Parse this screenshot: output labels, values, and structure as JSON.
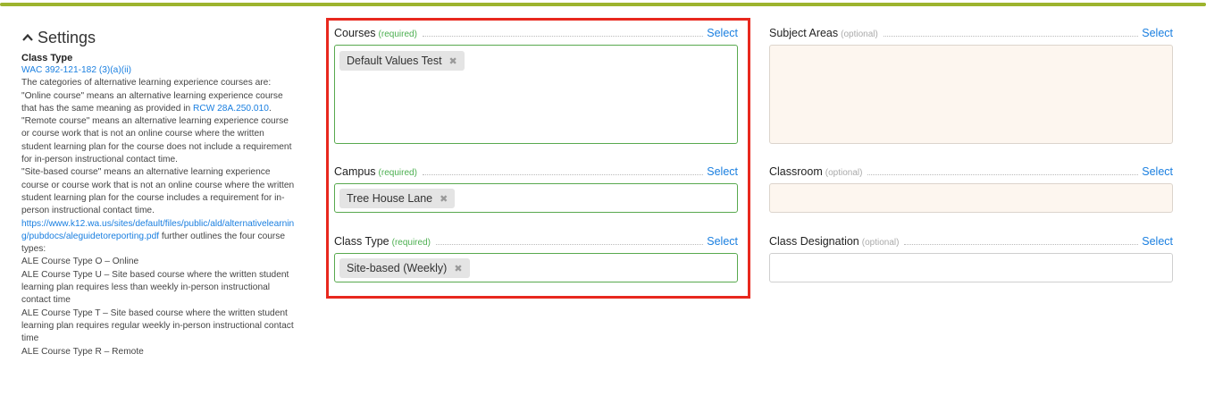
{
  "settings": {
    "title": "Settings",
    "class_type_label": "Class Type",
    "wac_link": "WAC 392-121-182 (3)(a)(ii)",
    "p1": "The categories of alternative learning experience courses are: \"Online course\" means an alternative learning experience course that has the same meaning as provided in ",
    "rcw_link": "RCW 28A.250.010",
    "p1_end": ".",
    "p2": "\"Remote course\" means an alternative learning experience course or course work that is not an online course where the written student learning plan for the course does not include a requirement for in-person instructional contact time.",
    "p3": "\"Site-based course\" means an alternative learning experience course or course work that is not an online course where the written student learning plan for the course includes a requirement for in-person instructional contact time.",
    "url_link": "https://www.k12.wa.us/sites/default/files/public/ald/alternativelearning/pubdocs/aleguidetoreporting.pdf",
    "p4": " further outlines the four course types:",
    "type_o": "ALE Course Type O – Online",
    "type_u": "ALE Course Type U – Site based course where the written student learning plan requires less than weekly in-person instructional contact time",
    "type_t": "ALE Course Type T – Site based course where the written student learning plan requires regular weekly in-person instructional contact time",
    "type_r": "ALE Course Type R – Remote"
  },
  "fields": {
    "courses": {
      "label": "Courses",
      "tag": "(required)",
      "select": "Select",
      "chip": "Default Values Test",
      "remove": "✖"
    },
    "campus": {
      "label": "Campus",
      "tag": "(required)",
      "select": "Select",
      "chip": "Tree House Lane",
      "remove": "✖"
    },
    "class_type": {
      "label": "Class Type",
      "tag": "(required)",
      "select": "Select",
      "chip": "Site-based (Weekly)",
      "remove": "✖"
    },
    "subject_areas": {
      "label": "Subject Areas",
      "tag": "(optional)",
      "select": "Select"
    },
    "classroom": {
      "label": "Classroom",
      "tag": "(optional)",
      "select": "Select"
    },
    "class_designation": {
      "label": "Class Designation",
      "tag": "(optional)",
      "select": "Select"
    }
  },
  "colors": {
    "accent_bar": "#9db42e",
    "link": "#1a7fe0",
    "required": "#4caf50",
    "highlight": "#e8281e"
  },
  "icons": {
    "settings_toggle": "chevron-up-icon",
    "chip_remove": "close-icon"
  }
}
